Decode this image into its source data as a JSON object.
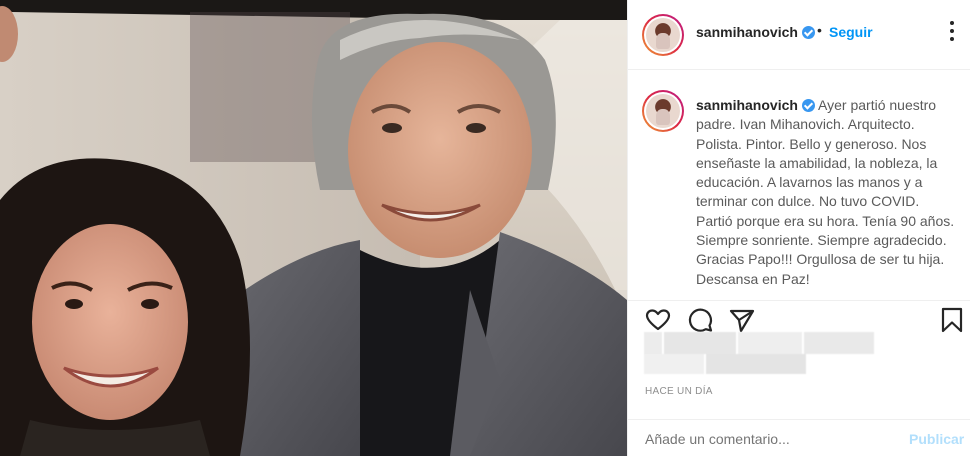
{
  "post": {
    "username": "sanmihanovich",
    "follow_label": "Seguir",
    "separator": "•",
    "caption": "Ayer partió nuestro padre. Ivan Mihanovich. Arquitecto. Polista. Pintor. Bello y generoso. Nos enseñaste la amabilidad, la nobleza, la educación. A lavarnos las manos y a terminar con dulce. No tuvo COVID. Partió porque era su hora. Tenía 90 años. Siempre sonriente. Siempre agradecido. Gracias Papo!!! Orgullosa de ser tu hija. Descansa en Paz!",
    "time_ago": "HACE UN DÍA",
    "comment_placeholder": "Añade un comentario...",
    "publish_label": "Publicar"
  },
  "icons": {
    "verified": "verified-badge-icon",
    "more": "more-options-icon",
    "like": "heart-icon",
    "comment": "comment-icon",
    "share": "share-icon",
    "save": "bookmark-icon"
  },
  "colors": {
    "link_blue": "#0095f6",
    "publish_disabled": "#b2dffc",
    "muted": "#8e8e8e",
    "text": "#262626"
  }
}
